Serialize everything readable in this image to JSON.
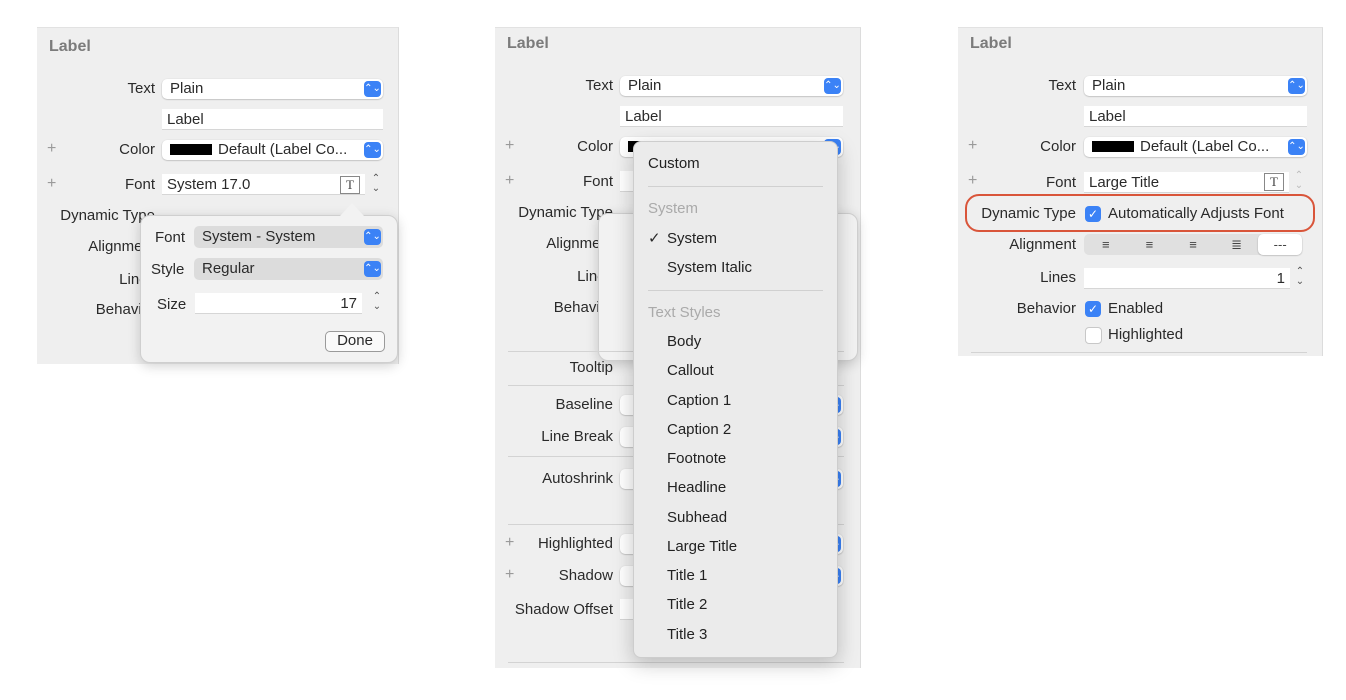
{
  "panel1": {
    "title": "Label",
    "text_label": "Text",
    "text_value": "Plain",
    "label_value": "Label",
    "color_label": "Color",
    "color_value": "Default (Label Co...",
    "font_label": "Font",
    "font_value": "System 17.0",
    "dynamic_label": "Dynamic Type",
    "alignment_label": "Alignment",
    "lines_label": "Lines",
    "behavior_label": "Behavior",
    "popover": {
      "font_label": "Font",
      "font_value": "System - System",
      "style_label": "Style",
      "style_value": "Regular",
      "size_label": "Size",
      "size_value": "17",
      "done": "Done"
    }
  },
  "panel2": {
    "title": "Label",
    "text_label": "Text",
    "text_value": "Plain",
    "label_value": "Label",
    "color_label": "Color",
    "font_label": "Font",
    "dynamic_label": "Dynamic Type",
    "alignment_label": "Alignment",
    "lines_label": "Lines",
    "behavior_label": "Behavior",
    "tooltip_label": "Tooltip",
    "baseline_label": "Baseline",
    "linebreak_label": "Line Break",
    "autoshrink_label": "Autoshrink",
    "highlighted_label": "Highlighted",
    "shadow_label": "Shadow",
    "shadow_offset_label": "Shadow Offset",
    "menu": {
      "custom": "Custom",
      "system_header": "System",
      "system": "System",
      "system_italic": "System Italic",
      "text_styles_header": "Text Styles",
      "styles": [
        "Body",
        "Callout",
        "Caption 1",
        "Caption 2",
        "Footnote",
        "Headline",
        "Subhead",
        "Large Title",
        "Title 1",
        "Title 2",
        "Title 3"
      ],
      "selected": "System"
    }
  },
  "panel3": {
    "title": "Label",
    "text_label": "Text",
    "text_value": "Plain",
    "label_value": "Label",
    "color_label": "Color",
    "color_value": "Default (Label Co...",
    "font_label": "Font",
    "font_value": "Large Title",
    "dynamic_label": "Dynamic Type",
    "dynamic_value": "Automatically Adjusts Font",
    "dynamic_checked": true,
    "alignment_label": "Alignment",
    "alignment_natural": "---",
    "lines_label": "Lines",
    "lines_value": "1",
    "behavior_label": "Behavior",
    "enabled": "Enabled",
    "enabled_checked": true,
    "highlighted": "Highlighted",
    "highlighted_checked": false
  },
  "colors": {
    "accent": "#3b82f6",
    "highlight_ring": "#d9553a",
    "panel": "#efefef"
  }
}
